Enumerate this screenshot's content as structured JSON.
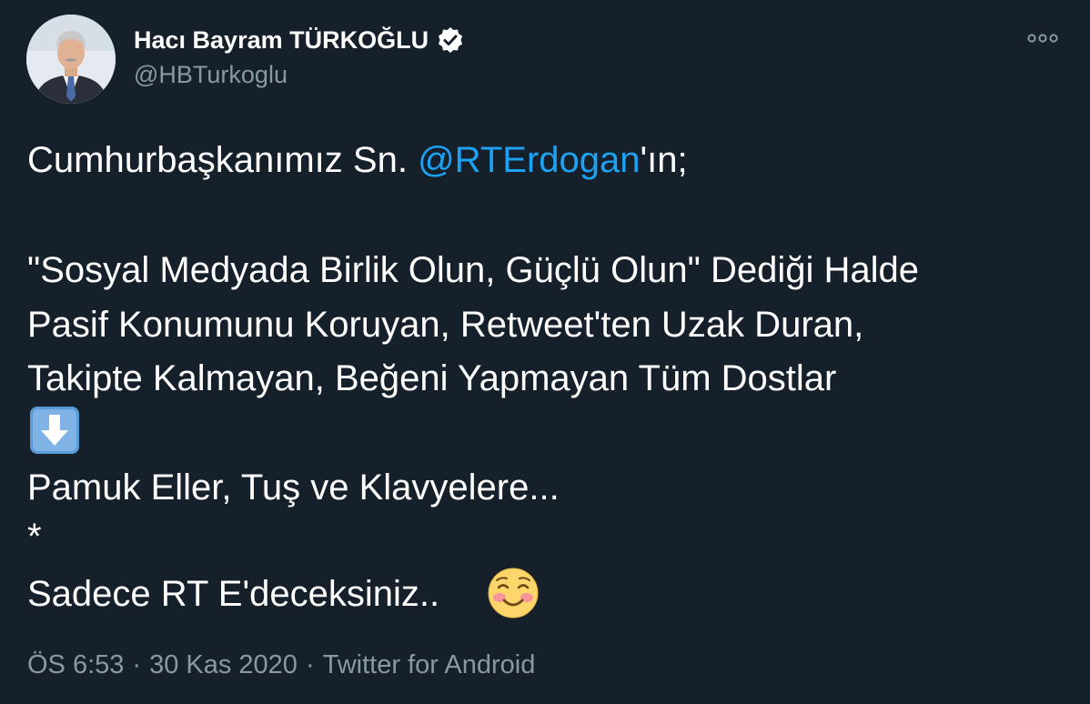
{
  "author": {
    "display_name": "Hacı Bayram TÜRKOĞLU",
    "handle": "@HBTurkoglu",
    "verified": true,
    "avatar_icon": "profile-photo"
  },
  "more_icon": "more-options-icon",
  "tweet": {
    "line1_prefix": "Cumhurbaşkanımız Sn. ",
    "line1_mention": "@RTErdogan",
    "line1_suffix": "'ın;",
    "line2": "\"Sosyal Medyada Birlik Olun, Güçlü Olun\" Dediği Halde",
    "line3": "Pasif Konumunu Koruyan, Retweet'ten Uzak Duran,",
    "line4": "Takipte Kalmayan, Beğeni Yapmayan Tüm Dostlar",
    "line5_icon": "down-arrow-emoji",
    "line6": "Pamuk Eller, Tuş ve Klavyelere...",
    "line7": "*",
    "line8": "Sadece RT E'deceksiniz..",
    "line8_icon": "smiling-blushing-emoji"
  },
  "meta": {
    "time": "ÖS 6:53",
    "separator": "·",
    "date": "30 Kas 2020",
    "source": "Twitter for Android"
  },
  "colors": {
    "background": "#15202b",
    "text": "#ffffff",
    "secondary": "#8899a6",
    "link": "#1da1f2"
  }
}
